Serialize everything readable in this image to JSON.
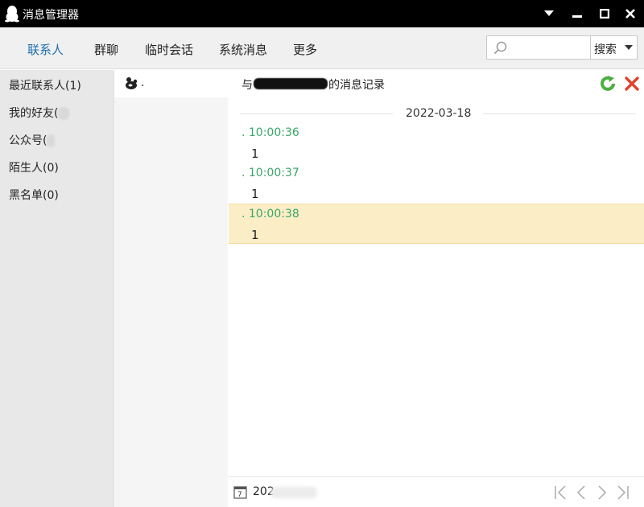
{
  "window": {
    "title": "消息管理器"
  },
  "tabs": [
    {
      "label": "联系人",
      "active": true
    },
    {
      "label": "群聊"
    },
    {
      "label": "临时会话"
    },
    {
      "label": "系统消息"
    },
    {
      "label": "更多"
    }
  ],
  "search": {
    "placeholder": "",
    "button_label": "搜索"
  },
  "categories": [
    {
      "label": "最近联系人(1)"
    },
    {
      "label": "我的好友("
    },
    {
      "label": "公众号("
    },
    {
      "label": "陌生人(0)"
    },
    {
      "label": "黑名单(0)"
    }
  ],
  "contact": {
    "name": "."
  },
  "conversation": {
    "header_prefix": "与",
    "header_suffix": "的消息记录",
    "date": "2022-03-18",
    "messages": [
      {
        "time": ". 10:00:36",
        "text": "1"
      },
      {
        "time": ". 10:00:37",
        "text": "1"
      },
      {
        "time": ". 10:00:38",
        "text": "1",
        "highlighted": true
      }
    ],
    "footer_date": "202"
  },
  "colors": {
    "accent": "#1d6fb0",
    "timestamp": "#3aa56a",
    "highlight": "#fbeec6",
    "titlebar": "#000000"
  }
}
